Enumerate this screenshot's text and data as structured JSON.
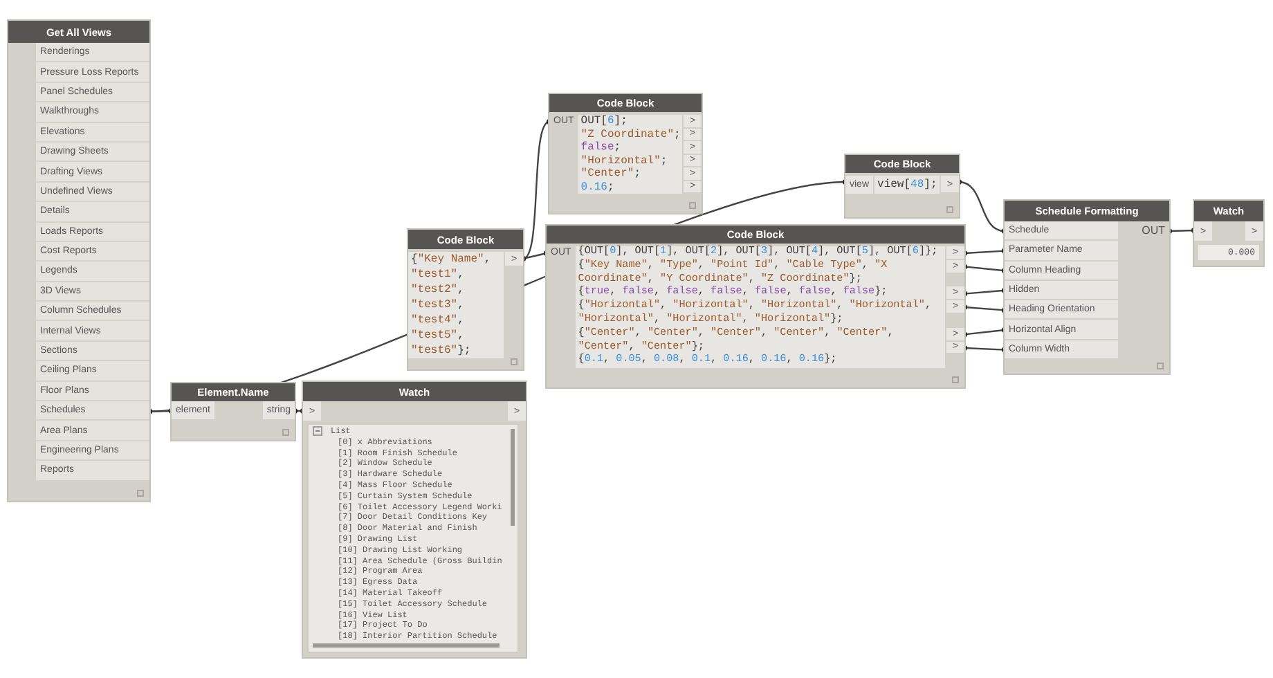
{
  "nodes": [
    {
      "kind": "list",
      "title": "Get All Views",
      "items": [
        "Renderings",
        "Pressure Loss Reports",
        "Panel Schedules",
        "Walkthroughs",
        "Elevations",
        "Drawing Sheets",
        "Drafting Views",
        "Undefined Views",
        "Details",
        "Loads Reports",
        "Cost Reports",
        "Legends",
        "3D Views",
        "Column Schedules",
        "Internal Views",
        "Sections",
        "Ceiling Plans",
        "Floor Plans",
        "Schedules",
        "Area Plans",
        "Engineering Plans",
        "Reports"
      ]
    },
    {
      "kind": "code",
      "title": "Code Block",
      "lines": [
        {
          "port": ">",
          "tokens": [
            {
              "kind": "p",
              "text": "{"
            },
            {
              "kind": "s",
              "text": "\"Key Name\""
            },
            {
              "kind": "p",
              "text": ","
            }
          ]
        },
        {
          "tokens": [
            {
              "kind": "s",
              "text": "\"test1\""
            },
            {
              "kind": "p",
              "text": ","
            }
          ]
        },
        {
          "tokens": [
            {
              "kind": "s",
              "text": "\"test2\""
            },
            {
              "kind": "p",
              "text": ","
            }
          ]
        },
        {
          "tokens": [
            {
              "kind": "s",
              "text": "\"test3\""
            },
            {
              "kind": "p",
              "text": ","
            }
          ]
        },
        {
          "tokens": [
            {
              "kind": "s",
              "text": "\"test4\""
            },
            {
              "kind": "p",
              "text": ","
            }
          ]
        },
        {
          "tokens": [
            {
              "kind": "s",
              "text": "\"test5\""
            },
            {
              "kind": "p",
              "text": ","
            }
          ]
        },
        {
          "tokens": [
            {
              "kind": "s",
              "text": "\"test6\""
            },
            {
              "kind": "p",
              "text": "};"
            }
          ]
        }
      ]
    },
    {
      "kind": "function",
      "title": "Element.Name",
      "inputs": [
        "element"
      ],
      "outputs": [
        "string"
      ]
    },
    {
      "kind": "watch_list",
      "title": "Watch",
      "input_port": ">",
      "output_port": ">",
      "root": "List",
      "items": [
        "[0] x Abbreviations",
        "[1] Room Finish Schedule",
        "[2] Window Schedule",
        "[3] Hardware Schedule",
        "[4] Mass Floor Schedule",
        "[5] Curtain System Schedule",
        "[6] Toilet Accessory Legend Worki",
        "[7] Door Detail Conditions Key",
        "[8] Door Material and Finish",
        "[9] Drawing List",
        "[10] Drawing List Working",
        "[11] Area Schedule (Gross Buildin",
        "[12] Program Area",
        "[13] Egress Data",
        "[14] Material Takeoff",
        "[15] Toilet Accessory Schedule",
        "[16] View List",
        "[17] Project To Do",
        "[18] Interior Partition Schedule"
      ]
    },
    {
      "kind": "code",
      "title": "Code Block",
      "inputs": [
        "OUT"
      ],
      "lines": [
        {
          "port": ">",
          "tokens": [
            {
              "kind": "p",
              "text": "OUT["
            },
            {
              "kind": "n",
              "text": "6"
            },
            {
              "kind": "p",
              "text": "];"
            }
          ]
        },
        {
          "port": ">",
          "tokens": [
            {
              "kind": "s",
              "text": "\"Z Coordinate\""
            },
            {
              "kind": "p",
              "text": ";"
            }
          ]
        },
        {
          "port": ">",
          "tokens": [
            {
              "kind": "k",
              "text": "false"
            },
            {
              "kind": "p",
              "text": ";"
            }
          ]
        },
        {
          "port": ">",
          "tokens": [
            {
              "kind": "s",
              "text": "\"Horizontal\""
            },
            {
              "kind": "p",
              "text": ";"
            }
          ]
        },
        {
          "port": ">",
          "tokens": [
            {
              "kind": "s",
              "text": "\"Center\""
            },
            {
              "kind": "p",
              "text": ";"
            }
          ]
        },
        {
          "port": ">",
          "tokens": [
            {
              "kind": "n",
              "text": "0.16"
            },
            {
              "kind": "p",
              "text": ";"
            }
          ]
        }
      ]
    },
    {
      "kind": "code",
      "title": "Code Block",
      "inputs": [
        "view"
      ],
      "lines": [
        {
          "port": ">",
          "tokens": [
            {
              "kind": "p",
              "text": "view["
            },
            {
              "kind": "n",
              "text": "48"
            },
            {
              "kind": "p",
              "text": "];"
            }
          ]
        }
      ]
    },
    {
      "kind": "code",
      "title": "Code Block",
      "inputs": [
        "OUT"
      ],
      "lines": [
        {
          "port": ">",
          "tokens": [
            {
              "kind": "p",
              "text": "{OUT["
            },
            {
              "kind": "n",
              "text": "0"
            },
            {
              "kind": "p",
              "text": "], OUT["
            },
            {
              "kind": "n",
              "text": "1"
            },
            {
              "kind": "p",
              "text": "], OUT["
            },
            {
              "kind": "n",
              "text": "2"
            },
            {
              "kind": "p",
              "text": "], OUT["
            },
            {
              "kind": "n",
              "text": "3"
            },
            {
              "kind": "p",
              "text": "], OUT["
            },
            {
              "kind": "n",
              "text": "4"
            },
            {
              "kind": "p",
              "text": "], OUT["
            },
            {
              "kind": "n",
              "text": "5"
            },
            {
              "kind": "p",
              "text": "], OUT["
            },
            {
              "kind": "n",
              "text": "6"
            },
            {
              "kind": "p",
              "text": "]};"
            }
          ]
        },
        {
          "port": ">",
          "tokens": [
            {
              "kind": "p",
              "text": "{"
            },
            {
              "kind": "s",
              "text": "\"Key Name\""
            },
            {
              "kind": "p",
              "text": ", "
            },
            {
              "kind": "s",
              "text": "\"Type\""
            },
            {
              "kind": "p",
              "text": ", "
            },
            {
              "kind": "s",
              "text": "\"Point Id\""
            },
            {
              "kind": "p",
              "text": ", "
            },
            {
              "kind": "s",
              "text": "\"Cable Type\""
            },
            {
              "kind": "p",
              "text": ", "
            },
            {
              "kind": "s",
              "text": "\"X"
            }
          ]
        },
        {
          "tokens": [
            {
              "kind": "s",
              "text": "Coordinate\""
            },
            {
              "kind": "p",
              "text": ", "
            },
            {
              "kind": "s",
              "text": "\"Y Coordinate\""
            },
            {
              "kind": "p",
              "text": ", "
            },
            {
              "kind": "s",
              "text": "\"Z Coordinate\""
            },
            {
              "kind": "p",
              "text": "};"
            }
          ]
        },
        {
          "port": ">",
          "tokens": [
            {
              "kind": "p",
              "text": "{"
            },
            {
              "kind": "k",
              "text": "true"
            },
            {
              "kind": "p",
              "text": ", "
            },
            {
              "kind": "k",
              "text": "false"
            },
            {
              "kind": "p",
              "text": ", "
            },
            {
              "kind": "k",
              "text": "false"
            },
            {
              "kind": "p",
              "text": ", "
            },
            {
              "kind": "k",
              "text": "false"
            },
            {
              "kind": "p",
              "text": ", "
            },
            {
              "kind": "k",
              "text": "false"
            },
            {
              "kind": "p",
              "text": ", "
            },
            {
              "kind": "k",
              "text": "false"
            },
            {
              "kind": "p",
              "text": ", "
            },
            {
              "kind": "k",
              "text": "false"
            },
            {
              "kind": "p",
              "text": "};"
            }
          ]
        },
        {
          "port": ">",
          "tokens": [
            {
              "kind": "p",
              "text": "{"
            },
            {
              "kind": "s",
              "text": "\"Horizontal\""
            },
            {
              "kind": "p",
              "text": ", "
            },
            {
              "kind": "s",
              "text": "\"Horizontal\""
            },
            {
              "kind": "p",
              "text": ", "
            },
            {
              "kind": "s",
              "text": "\"Horizontal\""
            },
            {
              "kind": "p",
              "text": ", "
            },
            {
              "kind": "s",
              "text": "\"Horizontal\""
            },
            {
              "kind": "p",
              "text": ","
            }
          ]
        },
        {
          "tokens": [
            {
              "kind": "s",
              "text": "\"Horizontal\""
            },
            {
              "kind": "p",
              "text": ", "
            },
            {
              "kind": "s",
              "text": "\"Horizontal\""
            },
            {
              "kind": "p",
              "text": ", "
            },
            {
              "kind": "s",
              "text": "\"Horizontal\""
            },
            {
              "kind": "p",
              "text": "};"
            }
          ]
        },
        {
          "port": ">",
          "tokens": [
            {
              "kind": "p",
              "text": "{"
            },
            {
              "kind": "s",
              "text": "\"Center\""
            },
            {
              "kind": "p",
              "text": ", "
            },
            {
              "kind": "s",
              "text": "\"Center\""
            },
            {
              "kind": "p",
              "text": ", "
            },
            {
              "kind": "s",
              "text": "\"Center\""
            },
            {
              "kind": "p",
              "text": ", "
            },
            {
              "kind": "s",
              "text": "\"Center\""
            },
            {
              "kind": "p",
              "text": ", "
            },
            {
              "kind": "s",
              "text": "\"Center\""
            },
            {
              "kind": "p",
              "text": ","
            }
          ]
        },
        {
          "port": ">",
          "tokens": [
            {
              "kind": "s",
              "text": "\"Center\""
            },
            {
              "kind": "p",
              "text": ", "
            },
            {
              "kind": "s",
              "text": "\"Center\""
            },
            {
              "kind": "p",
              "text": "};"
            }
          ]
        },
        {
          "tokens": [
            {
              "kind": "p",
              "text": "{"
            },
            {
              "kind": "n",
              "text": "0.1"
            },
            {
              "kind": "p",
              "text": ", "
            },
            {
              "kind": "n",
              "text": "0.05"
            },
            {
              "kind": "p",
              "text": ", "
            },
            {
              "kind": "n",
              "text": "0.08"
            },
            {
              "kind": "p",
              "text": ", "
            },
            {
              "kind": "n",
              "text": "0.1"
            },
            {
              "kind": "p",
              "text": ", "
            },
            {
              "kind": "n",
              "text": "0.16"
            },
            {
              "kind": "p",
              "text": ", "
            },
            {
              "kind": "n",
              "text": "0.16"
            },
            {
              "kind": "p",
              "text": ", "
            },
            {
              "kind": "n",
              "text": "0.16"
            },
            {
              "kind": "p",
              "text": "};"
            }
          ]
        }
      ]
    },
    {
      "kind": "function",
      "title": "Schedule Formatting",
      "inputs": [
        "Schedule",
        "Parameter Name",
        "Column Heading",
        "Hidden",
        "Heading Orientation",
        "Horizontal Align",
        "Column Width"
      ],
      "outputs": [
        "OUT"
      ]
    },
    {
      "kind": "watch_value",
      "title": "Watch",
      "input_port": ">",
      "output_port": ">",
      "value": "0.000"
    }
  ]
}
